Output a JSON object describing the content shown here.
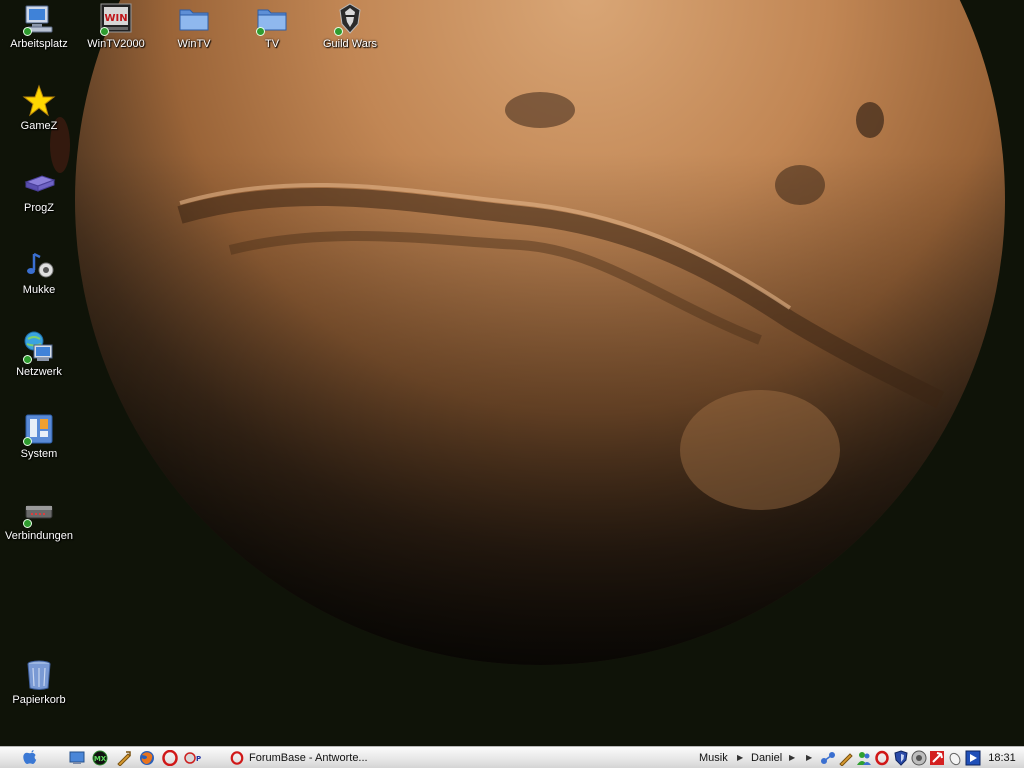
{
  "desktop": {
    "icons": [
      {
        "label": "Arbeitsplatz",
        "icon": "my-computer-icon"
      },
      {
        "label": "WinTV2000",
        "icon": "wintv-icon"
      },
      {
        "label": "WinTV",
        "icon": "folder-icon"
      },
      {
        "label": "TV",
        "icon": "folder-icon"
      },
      {
        "label": "Guild Wars",
        "icon": "guild-wars-icon"
      },
      {
        "label": "GameZ",
        "icon": "star-icon"
      },
      {
        "label": "ProgZ",
        "icon": "drive-icon"
      },
      {
        "label": "Mukke",
        "icon": "music-icon"
      },
      {
        "label": "Netzwerk",
        "icon": "network-icon"
      },
      {
        "label": "System",
        "icon": "system-icon"
      },
      {
        "label": "Verbindungen",
        "icon": "modem-icon"
      },
      {
        "label": "Papierkorb",
        "icon": "recycle-bin-icon"
      }
    ]
  },
  "taskbar": {
    "start_icon": "apple-icon",
    "quick_launch": [
      "desktop-icon",
      "mx-icon",
      "tool-icon",
      "firefox-icon",
      "opera-icon",
      "ftp-icon"
    ],
    "task_button": {
      "label": "ForumBase - Antworte...",
      "icon": "opera-icon"
    },
    "menu_musik": "Musik",
    "menu_daniel": "Daniel",
    "tray_icons": [
      "network-tray-icon",
      "tool-tray-icon",
      "messenger-icon",
      "opera-tray-icon",
      "shield-icon",
      "speaker-icon",
      "antivirus-icon",
      "mouse-icon",
      "media-player-icon"
    ],
    "clock": "18:31"
  },
  "colors": {
    "taskbar_bg": "#e8e8e8",
    "desktop_bg": "#0f1308",
    "mars": "#b87a46"
  }
}
